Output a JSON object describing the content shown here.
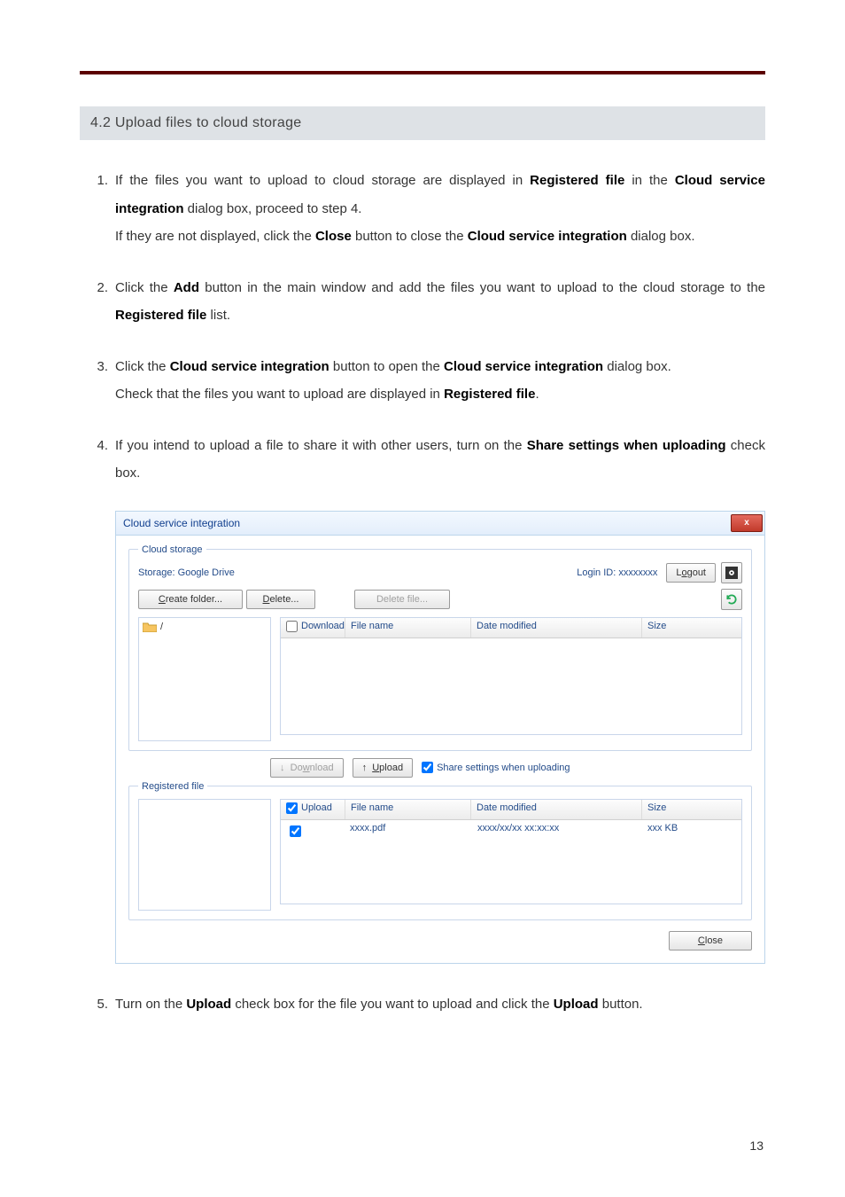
{
  "section_title": "4.2 Upload files to cloud storage",
  "steps": [
    {
      "num": "1.",
      "html": "If the files you want to upload to cloud storage are displayed in <b>Registered file</b> in the <b>Cloud service integration</b> dialog box, proceed to step 4.<br>If they are not displayed, click the <b>Close</b> button to close the <b>Cloud service integration</b> dialog box."
    },
    {
      "num": "2.",
      "html": "Click the <b>Add</b> button in the main window and add the files you want to upload to the cloud storage to the <b>Registered file</b> list."
    },
    {
      "num": "3.",
      "html": "Click the <b>Cloud service integration</b> button to open the <b>Cloud service integration</b> dialog box.<br>Check that the files you want to upload are displayed in <b>Registered file</b>."
    },
    {
      "num": "4.",
      "html": "If you intend to upload a file to share it with other users, turn on the <b>Share settings when uploading</b> check box."
    },
    {
      "num": "5.",
      "html": "Turn on the <b>Upload</b> check box for the file you want to upload and click the <b>Upload</b> button."
    }
  ],
  "dialog": {
    "title": "Cloud service integration",
    "close_x": "x",
    "group_cloud": "Cloud storage",
    "storage_label": "Storage: Google Drive",
    "login_id": "Login ID: xxxxxxxx",
    "logout": "Logout",
    "create_folder": "Create folder...",
    "delete": "Delete...",
    "delete_file": "Delete file...",
    "tree_root": "/",
    "col_download": "Download",
    "col_upload": "Upload",
    "col_filename": "File name",
    "col_date": "Date modified",
    "col_size": "Size",
    "download_btn_pre": "Do",
    "download_btn_u": "w",
    "download_btn_post": "nload",
    "upload_btn_u": "U",
    "upload_btn_post": "pload",
    "share_label": "Share settings when uploading",
    "group_registered": "Registered file",
    "row_file": "xxxx.pdf",
    "row_date": "xxxx/xx/xx xx:xx:xx",
    "row_size": "xxx KB",
    "close_btn_u": "C",
    "close_btn_post": "lose"
  },
  "page_number": "13"
}
